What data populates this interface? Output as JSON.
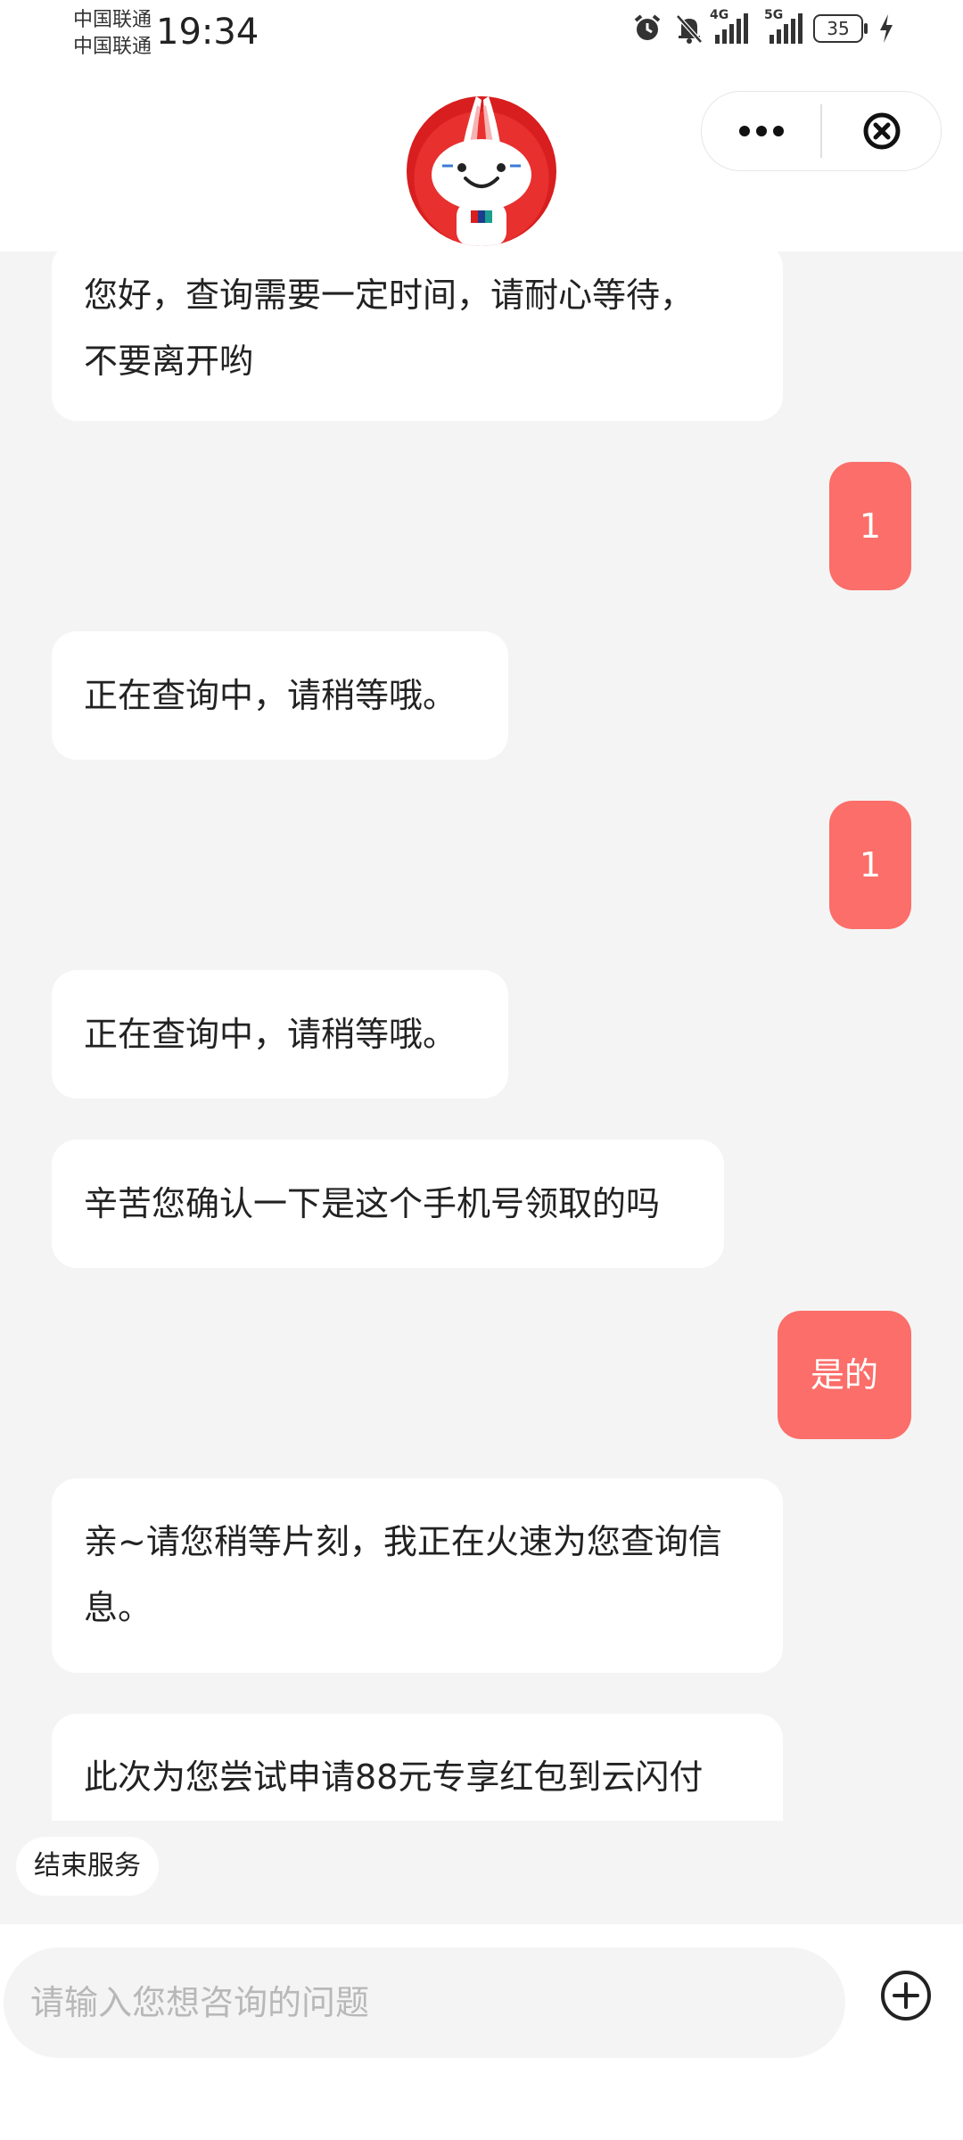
{
  "status_bar": {
    "carrier1": "中国联通",
    "carrier2": "中国联通",
    "time": "19:34",
    "net1": "4G",
    "net2": "5G",
    "battery": "35",
    "icons": [
      "alarm-icon",
      "mute-bell-icon",
      "signal-4g-icon",
      "signal-5g-icon",
      "battery-icon",
      "charging-icon"
    ]
  },
  "header": {
    "avatar": "rabbit-mascot-avatar",
    "more_icon": "more-dots-icon",
    "close_icon": "close-circle-icon"
  },
  "messages": [
    {
      "from": "bot",
      "line1": "您好，查询需要一定时间，请耐心等待，",
      "line2": "不要离开哟"
    },
    {
      "from": "user",
      "text": "1"
    },
    {
      "from": "bot",
      "text": "正在查询中，请稍等哦。"
    },
    {
      "from": "user",
      "text": "1"
    },
    {
      "from": "bot",
      "text": "正在查询中，请稍等哦。"
    },
    {
      "from": "bot",
      "text": "辛苦您确认一下是这个手机号领取的吗"
    },
    {
      "from": "user",
      "text": "是的"
    },
    {
      "from": "bot",
      "line1": "亲~请您稍等片刻，我正在火速为您查询信",
      "line2": "息。"
    },
    {
      "from": "bot",
      "text": "此次为您尝试申请88元专享红包到云闪付"
    }
  ],
  "actions": {
    "end_service": "结束服务"
  },
  "input": {
    "placeholder": "请输入您想咨询的问题",
    "plus_icon": "plus-circle-icon"
  },
  "colors": {
    "user_bubble": "#fb6e69",
    "background": "#f4f4f4",
    "brand_red": "#e8302e"
  }
}
